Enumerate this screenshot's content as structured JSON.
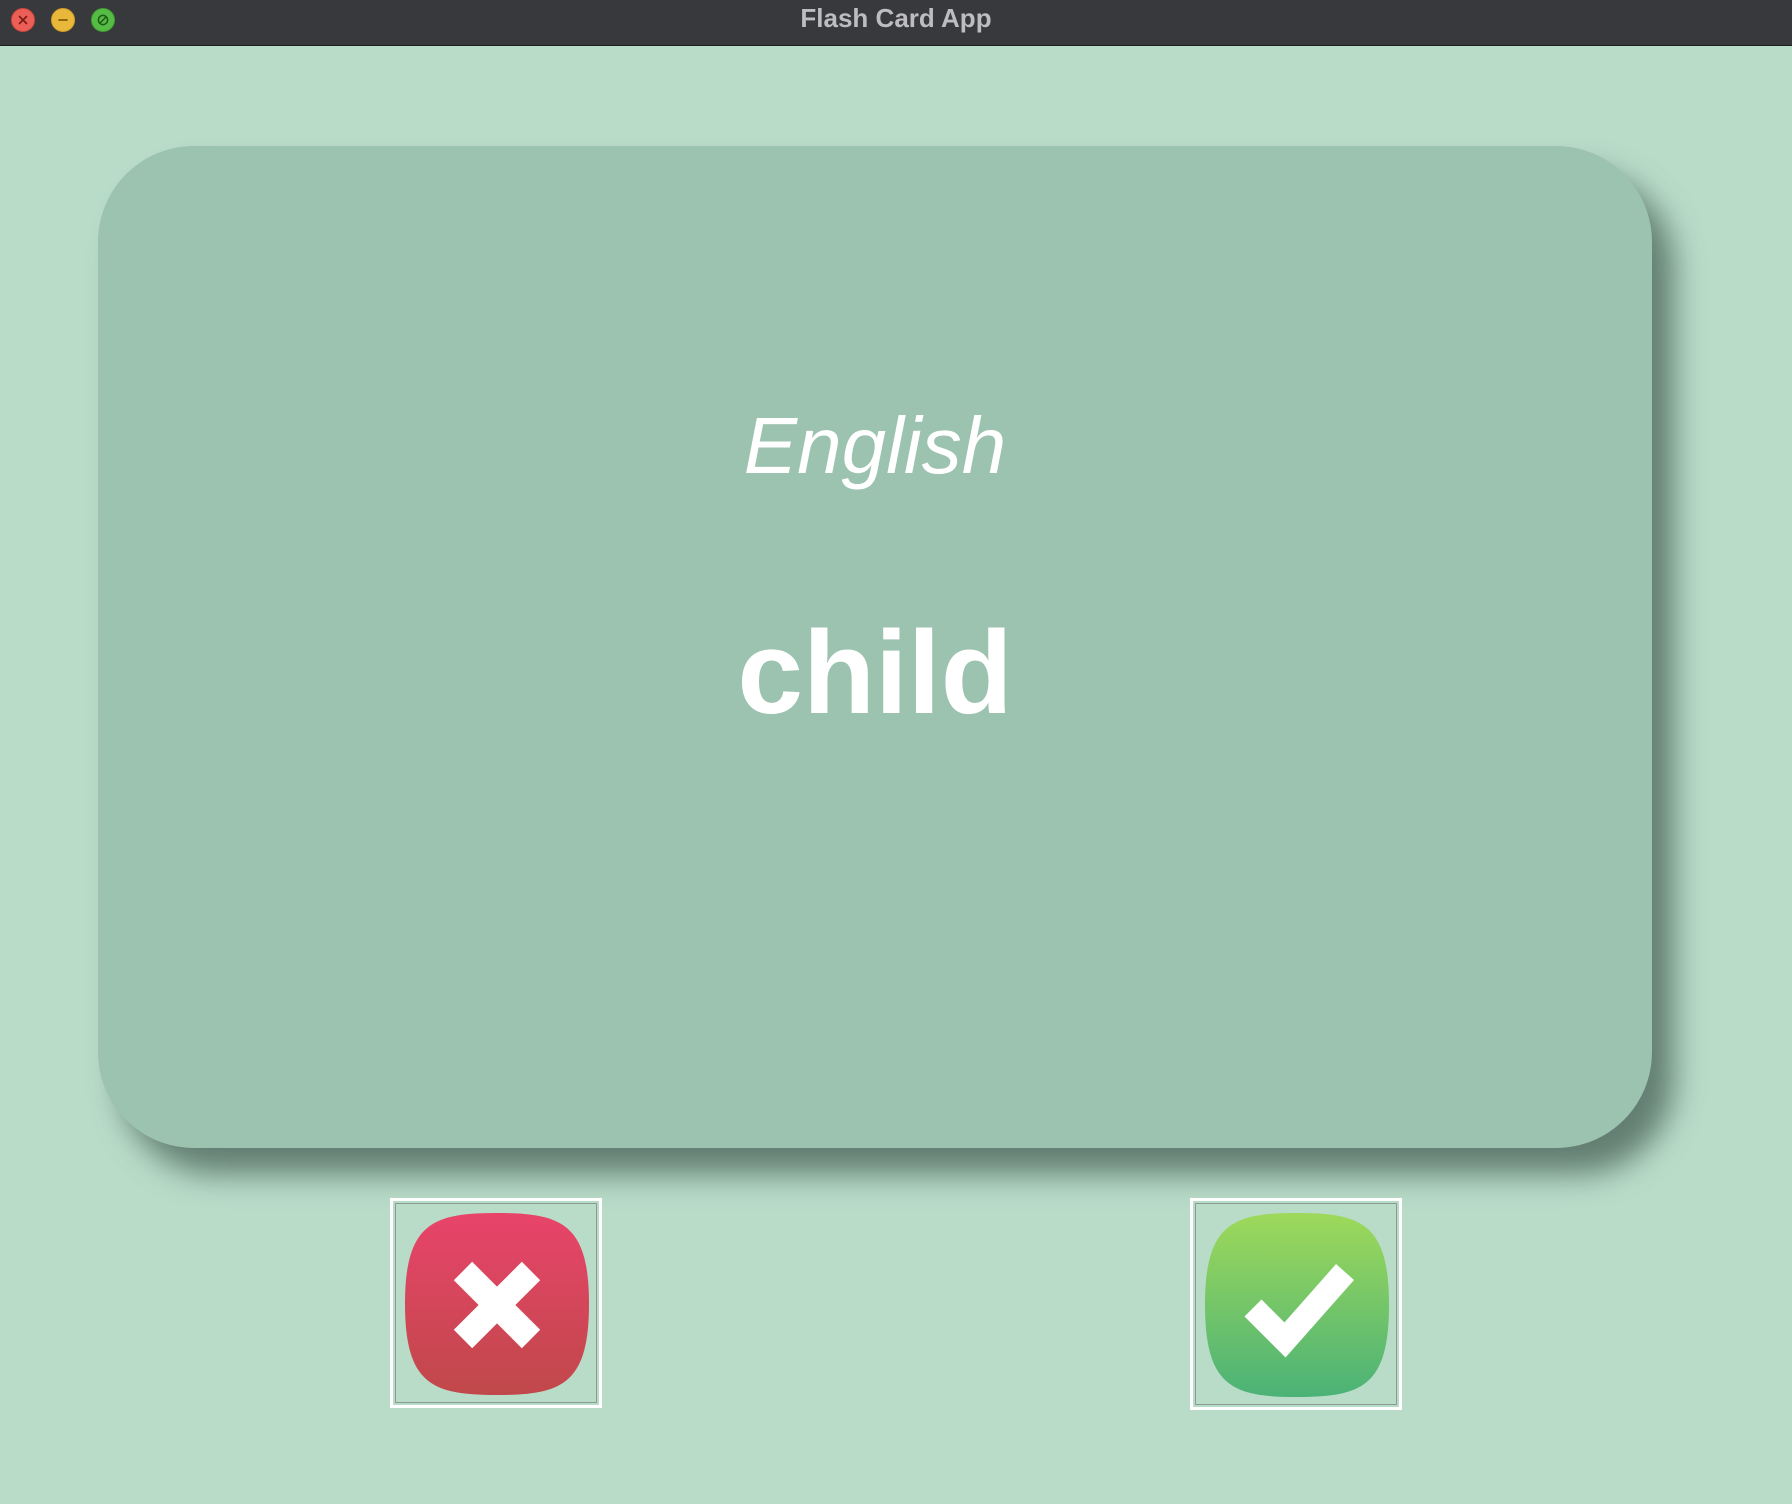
{
  "window": {
    "title": "Flash Card App",
    "controls": [
      "close-icon",
      "minimize-icon",
      "zoom-icon"
    ]
  },
  "card": {
    "language": "English",
    "word": "child"
  },
  "buttons": {
    "wrong": {
      "icon": "cross-icon",
      "color_top": "#E8446A",
      "color_bottom": "#C0484A"
    },
    "right": {
      "icon": "checkmark-icon",
      "color_top": "#9ED95A",
      "color_bottom": "#4BB277"
    }
  },
  "colors": {
    "background": "#B9DCC8",
    "card": "#9CC2B0",
    "titlebar": "#38393C"
  }
}
